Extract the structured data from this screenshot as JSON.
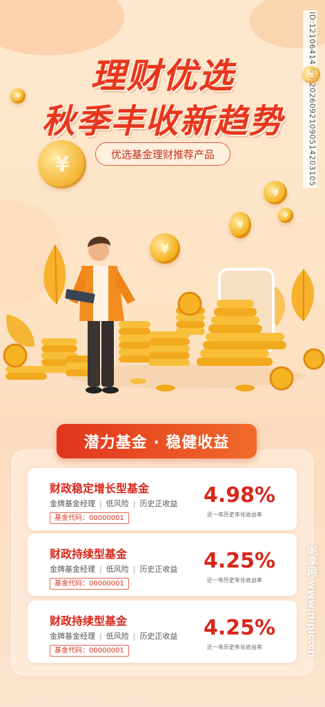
{
  "header": {
    "title_line1": "理财优选",
    "title_line2": "秋季丰收新趋势",
    "subtitle": "优选基金理财推荐产品"
  },
  "coin_symbol": "¥",
  "watermark": {
    "id_text": "ID:12106414 NO:20260921090514203105",
    "site_text": "昵享网 www.nipic.cn"
  },
  "section": {
    "banner": "潜力基金 · 稳健收益"
  },
  "funds": [
    {
      "name": "财政稳定增长型基金",
      "tags": [
        "金牌基金经理",
        "低风险",
        "历史正收益"
      ],
      "code": "基金代码：00000001",
      "rate": "4.98%",
      "rate_label": "近一年历史年化收益率"
    },
    {
      "name": "财政持续型基金",
      "tags": [
        "金牌基金经理",
        "低风险",
        "历史正收益"
      ],
      "code": "基金代码：00000001",
      "rate": "4.25%",
      "rate_label": "近一年历史年化收益率"
    },
    {
      "name": "财政持续型基金",
      "tags": [
        "金牌基金经理",
        "低风险",
        "历史正收益"
      ],
      "code": "基金代码：00000001",
      "rate": "4.25%",
      "rate_label": "近一年历史年化收益率"
    }
  ],
  "colors": {
    "brand_red": "#e8361e",
    "gold": "#f6b324",
    "background": "#fde3c4"
  }
}
